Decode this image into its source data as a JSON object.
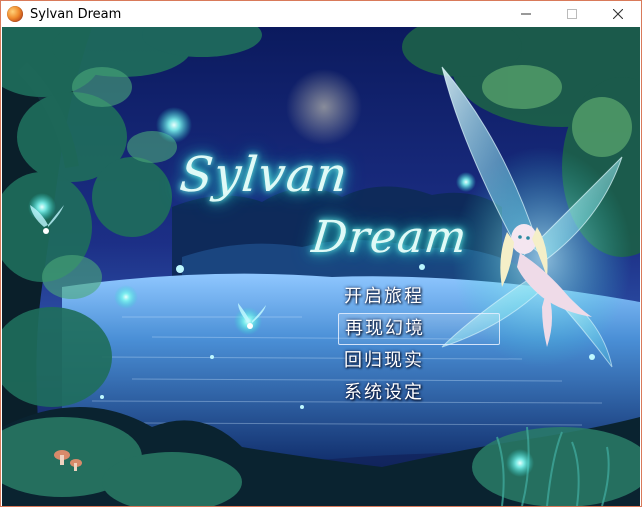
{
  "window": {
    "title": "Sylvan Dream",
    "app_icon": "orange-sphere-icon",
    "controls": [
      "minimize-icon",
      "maximize-icon",
      "close-icon"
    ]
  },
  "logo": {
    "line1": "Sylvan",
    "line2": "Dream",
    "glow_color": "#6ff0e8"
  },
  "menu": {
    "items": [
      {
        "label": "开启旅程"
      },
      {
        "label": "再现幻境"
      },
      {
        "label": "回归现实"
      },
      {
        "label": "系统设定"
      }
    ],
    "selected_index": 1
  },
  "colors": {
    "sky": "#0a1440",
    "lake": "#3d86c9",
    "moon": "#fff6c8",
    "firefly": "#7ff5f0"
  }
}
